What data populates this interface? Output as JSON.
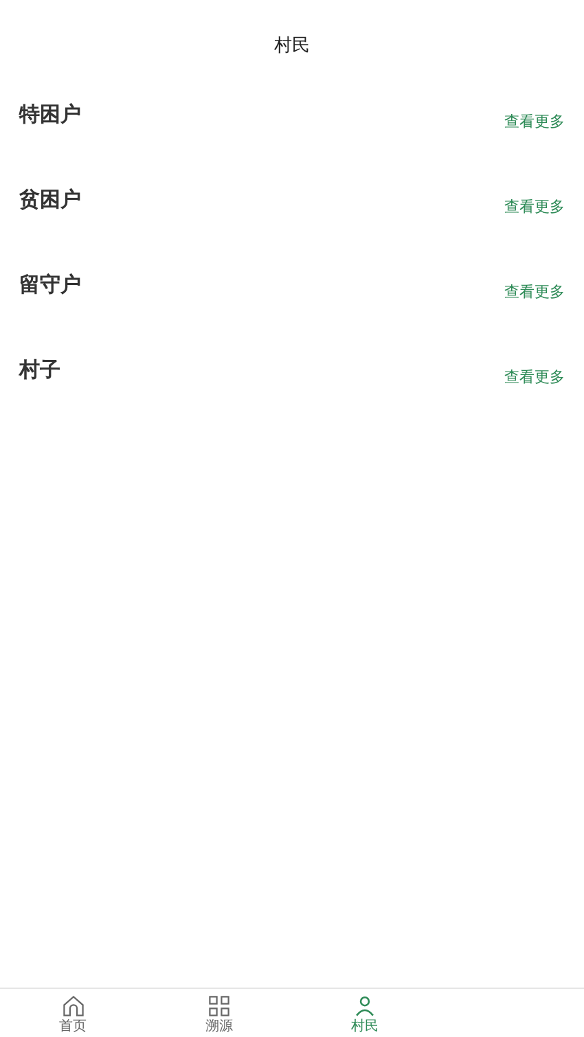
{
  "header": {
    "title": "村民"
  },
  "sections": [
    {
      "title": "特困户",
      "link": "查看更多"
    },
    {
      "title": "贫困户",
      "link": "查看更多"
    },
    {
      "title": "留守户",
      "link": "查看更多"
    },
    {
      "title": "村子",
      "link": "查看更多"
    }
  ],
  "tab_bar": [
    {
      "label": "首页",
      "kind": "home",
      "selected": false
    },
    {
      "label": "溯源",
      "kind": "grid",
      "selected": false
    },
    {
      "label": "村民",
      "kind": "people",
      "selected": true
    }
  ]
}
